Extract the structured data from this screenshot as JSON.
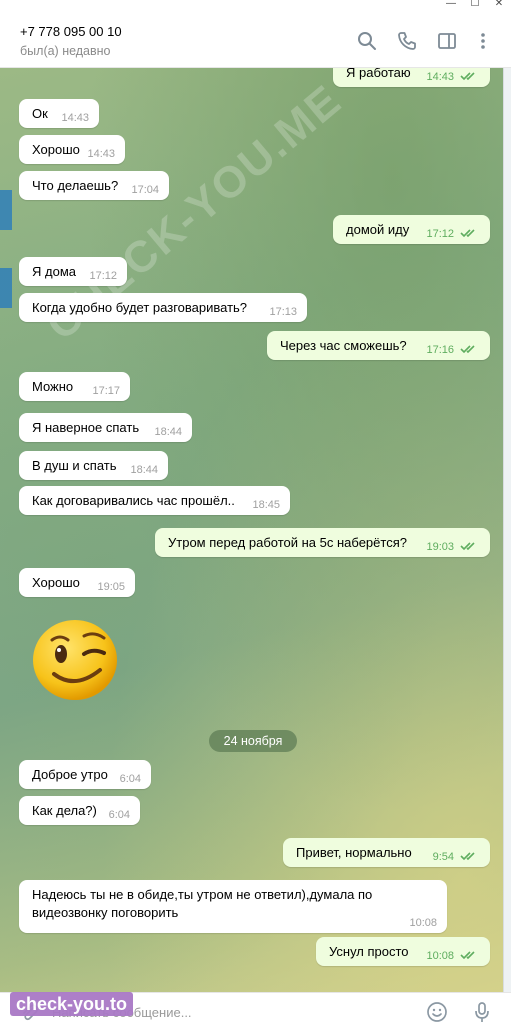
{
  "window": {
    "min": "—",
    "max": "☐",
    "close": "✕"
  },
  "header": {
    "name": "+7 778 095 00 10",
    "status": "был(а) недавно",
    "icons": [
      "search-icon",
      "phone-icon",
      "sidebar-icon",
      "more-icon"
    ]
  },
  "messages": [
    {
      "dir": "out",
      "text": "Я работаю",
      "time": "14:43",
      "read": true
    },
    {
      "dir": "in",
      "text": "Ок",
      "time": "14:43"
    },
    {
      "dir": "in",
      "text": "Хорошо",
      "time": "14:43"
    },
    {
      "dir": "in",
      "text": "Что делаешь?",
      "time": "17:04"
    },
    {
      "dir": "out",
      "text": "домой иду",
      "time": "17:12",
      "read": true
    },
    {
      "dir": "in",
      "text": "Я дома",
      "time": "17:12"
    },
    {
      "dir": "in",
      "text": "Когда удобно будет разговаривать?",
      "time": "17:13"
    },
    {
      "dir": "out",
      "text": "Через час сможешь?",
      "time": "17:16",
      "read": true
    },
    {
      "dir": "in",
      "text": "Можно",
      "time": "17:17"
    },
    {
      "dir": "in",
      "text": "Я наверное спать",
      "time": "18:44"
    },
    {
      "dir": "in",
      "text": "В душ и спать",
      "time": "18:44"
    },
    {
      "dir": "in",
      "text": "Как договаривались час прошёл..",
      "time": "18:45"
    },
    {
      "dir": "out",
      "text": "Утром перед работой на 5с наберётся?",
      "time": "19:03",
      "read": true
    },
    {
      "dir": "in",
      "text": "Хорошо",
      "time": "19:05"
    },
    {
      "dir": "in",
      "text": "Доброе утро",
      "time": "6:04"
    },
    {
      "dir": "in",
      "text": "Как дела?)",
      "time": "6:04"
    },
    {
      "dir": "out",
      "text": "Привет, нормально",
      "time": "9:54",
      "read": true
    },
    {
      "dir": "in",
      "text": "Надеюсь ты не в обиде,ты утром не ответил),думала по видеозвонку поговорить",
      "time": "10:08"
    },
    {
      "dir": "out",
      "text": "Уснул просто",
      "time": "10:08",
      "read": true
    }
  ],
  "sticker": {
    "icon": "winking-face-sticker",
    "glyph": "😉"
  },
  "date_separator": "24 ноября",
  "watermark": "CHECK-YOU.ME",
  "composer": {
    "placeholder": "Написать сообщение...",
    "value": ""
  },
  "logo_watermark": "check-you.to",
  "colors": {
    "incoming": "#ffffff",
    "outgoing": "#effdde",
    "read_ticks": "#5fad5f",
    "date_pill": "#5f7d55"
  }
}
